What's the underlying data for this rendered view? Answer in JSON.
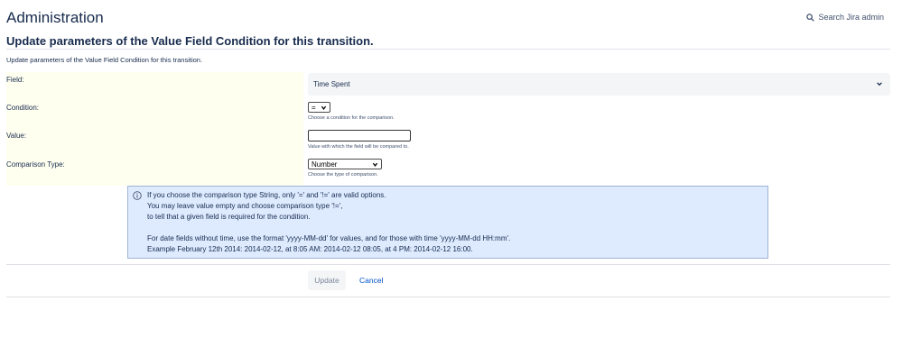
{
  "header": {
    "title": "Administration",
    "search_label": "Search Jira admin",
    "search_icon": "search-icon"
  },
  "page": {
    "heading": "Update parameters of the Value Field Condition for this transition.",
    "description": "Update parameters of the Value Field Condition for this transition."
  },
  "form": {
    "field": {
      "label": "Field:",
      "value": "Time Spent"
    },
    "condition": {
      "label": "Condition:",
      "value": "=",
      "hint": "Choose a condition for the comparison."
    },
    "value": {
      "label": "Value:",
      "value": "",
      "hint": "Value with which the field will be compared to."
    },
    "comparison_type": {
      "label": "Comparison Type:",
      "value": "Number",
      "hint": "Choose the type of comparison."
    }
  },
  "info": {
    "icon": "info-icon",
    "lines": [
      "If you choose the comparison type String, only '=' and '!=' are valid options.",
      "You may leave value empty and choose comparison type '!=',",
      "to tell that a given field is required for the condition.",
      "",
      "For date fields without time, use the format 'yyyy-MM-dd' for values, and for those with time 'yyyy-MM-dd HH:mm'.",
      "Example February 12th 2014: 2014-02-12, at 8:05 AM: 2014-02-12 08:05, at 4 PM: 2014-02-12 16:00."
    ]
  },
  "actions": {
    "update_label": "Update",
    "cancel_label": "Cancel"
  },
  "colors": {
    "info_background": "#deebff",
    "label_background": "#fffff0",
    "link": "#0052cc"
  }
}
